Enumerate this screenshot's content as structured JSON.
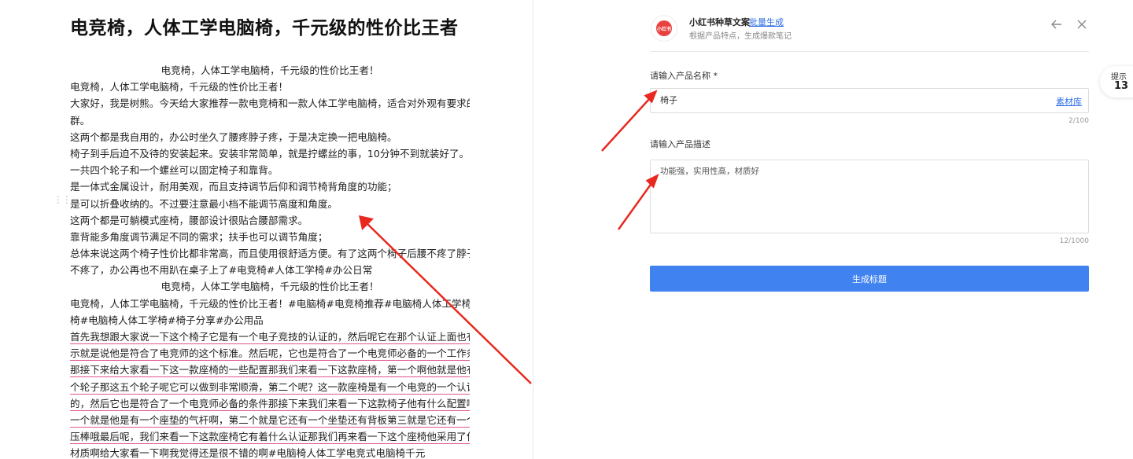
{
  "document": {
    "title": "电竞椅，人体工学电脑椅，千元级的性价比王者",
    "lines": [
      {
        "text": "电竞椅，人体工学电脑椅，千元级的性价比王者！",
        "align": "center",
        "underline": false
      },
      {
        "text": "电竞椅，人体工学电脑椅，千元级的性价比王者！",
        "align": "left",
        "underline": false
      },
      {
        "text": "大家好，我是树熊。今天给大家推荐一款电竞椅和一款人体工学电脑椅，适合对外观有要求的人",
        "align": "left",
        "underline": false
      },
      {
        "text": "群。",
        "align": "left",
        "underline": false
      },
      {
        "text": "这两个都是我自用的，办公时坐久了腰疼脖子疼，于是决定换一把电脑椅。",
        "align": "left",
        "underline": false
      },
      {
        "text": "椅子到手后迫不及待的安装起来。安装非常简单，就是拧螺丝的事，10分钟不到就装好了。",
        "align": "left",
        "underline": false
      },
      {
        "text": "一共四个轮子和一个螺丝可以固定椅子和靠背。",
        "align": "left",
        "underline": false
      },
      {
        "text": "是一体式金属设计，耐用美观，而且支持调节后仰和调节椅背角度的功能；",
        "align": "left",
        "underline": false
      },
      {
        "text": "是可以折叠收纳的。不过要注意最小档不能调节高度和角度。",
        "align": "left",
        "underline": false
      },
      {
        "text": "这两个都是可躺模式座椅，腰部设计很贴合腰部需求。",
        "align": "left",
        "underline": false
      },
      {
        "text": "靠背能多角度调节满足不同的需求；扶手也可以调节角度；",
        "align": "left",
        "underline": false
      },
      {
        "text": "总体来说这两个椅子性价比都非常高，而且使用很舒适方便。有了这两个椅子后腰不疼了脖子也",
        "align": "left",
        "underline": false
      },
      {
        "text": "不疼了，办公再也不用趴在桌子上了#电竞椅#人体工学椅#办公日常",
        "align": "left",
        "underline": false
      },
      {
        "text": "电竞椅，人体工学电脑椅，千元级的性价比王者！",
        "align": "center",
        "underline": false
      },
      {
        "text": "电竞椅，人体工学电脑椅，千元级的性价比王者！#电脑椅#电竞椅推荐#电脑椅人体工学椅电竞",
        "align": "left",
        "underline": false
      },
      {
        "text": "椅#电脑椅人体工学椅#椅子分享#办公用品",
        "align": "left",
        "underline": false
      },
      {
        "text": "首先我想跟大家说一下这个椅子它是有一个电子竞技的认证的，然后呢它在那个认证上面也有显",
        "align": "left",
        "underline": true
      },
      {
        "text": "示就是说他是符合了电竞师的这个标准。然后呢，它也是符合了一个电竞师必备的一个工作条件",
        "align": "left",
        "underline": true
      },
      {
        "text": "那接下来给大家看一下这一款座椅的一些配置那我们来看一下这款座椅，第一个啊他就是他有五",
        "align": "left",
        "underline": true
      },
      {
        "text": "个轮子那这五个轮子呢它可以做到非常顺滑，第二个呢？这一款座椅是有一个电竞的一个认证",
        "align": "left",
        "underline": true
      },
      {
        "text": "的，然后它也是符合了一个电竞师必备的条件那接下来我们来看一下这款椅子他有什么配置啊第",
        "align": "left",
        "underline": true
      },
      {
        "text": "一个就是他是有一个座垫的气杆啊，第二个就是它还有一个坐垫还有背板第三就是它还有一个气",
        "align": "left",
        "underline": true
      },
      {
        "text": "压棒哦最后呢，我们来看一下这款座椅它有着什么认证那我们再来看一下这个座椅他采用了什么",
        "align": "left",
        "underline": true
      },
      {
        "text": "材质啊给大家看一下啊我觉得还是很不错的啊#电脑椅人体工学电竞式电脑椅千元",
        "align": "left",
        "underline": true
      }
    ]
  },
  "panel": {
    "logo_text": "小红书",
    "app_name": "小红书种草文案",
    "batch_link": "批量生成",
    "subtitle": "根据产品特点，生成爆款笔记",
    "name_label": "请输入产品名称 *",
    "name_value": "椅子",
    "material_link": "素材库",
    "name_counter": "2/100",
    "desc_label": "请输入产品描述",
    "desc_value": "功能强，实用性高，材质好",
    "desc_counter": "12/1000",
    "generate_button": "生成标题"
  },
  "tip": {
    "label": "提示",
    "count": "13"
  },
  "colors": {
    "accent": "#3f82f0",
    "link": "#2f6fe6",
    "arrow": "#e8291f",
    "underline_pink": "#e0558f"
  }
}
